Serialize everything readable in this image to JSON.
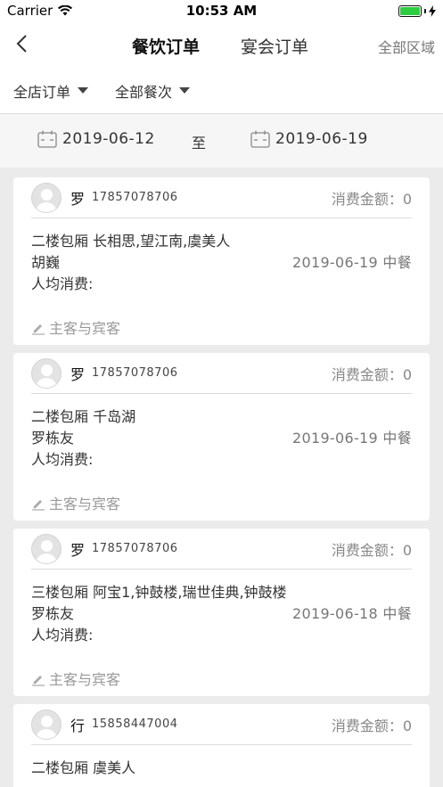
{
  "status_bar": {
    "carrier": "Carrier",
    "time": "10:53 AM",
    "battery_level": 1.0
  },
  "nav": {
    "tab_active": "餐饮订单",
    "tab_inactive": "宴会订单",
    "area": "全部区域"
  },
  "filters": {
    "store": "全店订单",
    "meal": "全部餐次"
  },
  "dates": {
    "start": "2019-06-12",
    "separator": "至",
    "end": "2019-06-19"
  },
  "orders": [
    {
      "name": "罗",
      "phone": "17857078706",
      "amount": "消费金额：0",
      "room": "二楼包厢 长相思,望江南,虞美人",
      "host": "胡巍",
      "meal": "2019-06-19 中餐",
      "per_person": "人均消费:",
      "guest_link": "主客与宾客"
    },
    {
      "name": "罗",
      "phone": "17857078706",
      "amount": "消费金额：0",
      "room": "二楼包厢 千岛湖",
      "host": "罗栋友",
      "meal": "2019-06-19 中餐",
      "per_person": "人均消费:",
      "guest_link": "主客与宾客"
    },
    {
      "name": "罗",
      "phone": "17857078706",
      "amount": "消费金额：0",
      "room": "三楼包厢 阿宝1,钟鼓楼,瑞世佳典,钟鼓楼",
      "host": "罗栋友",
      "meal": "2019-06-18 中餐",
      "per_person": "人均消费:",
      "guest_link": "主客与宾客"
    },
    {
      "name": "行",
      "phone": "15858447004",
      "amount": "消费金额：0",
      "room": "二楼包厢 虞美人"
    }
  ]
}
